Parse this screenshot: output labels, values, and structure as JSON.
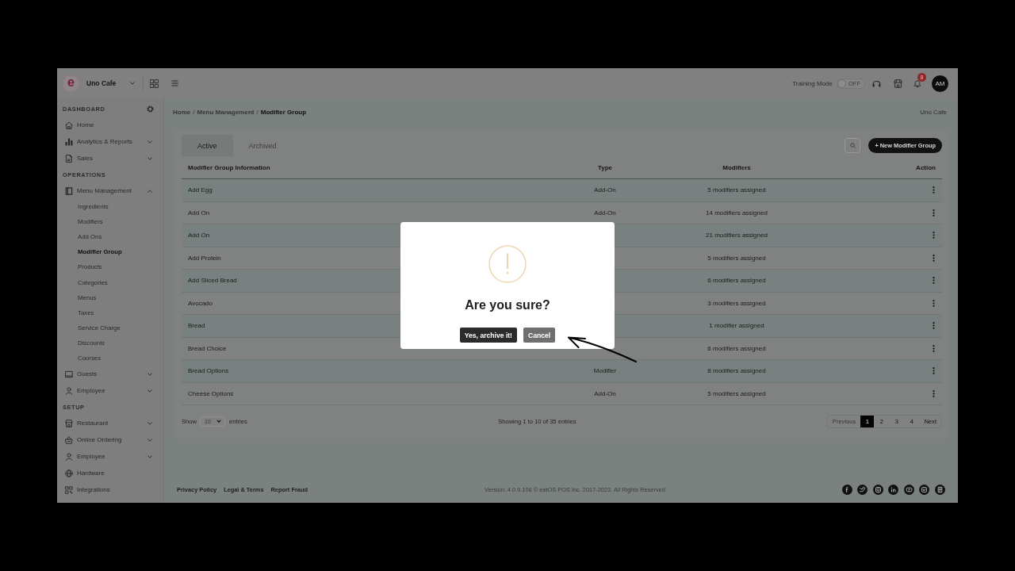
{
  "topbar": {
    "brand": {
      "logo": "e",
      "name": "Uno Cafe"
    },
    "training_mode": {
      "label": "Training Mode",
      "on": false,
      "state_label": "OFF"
    },
    "notifications": {
      "count": "8"
    },
    "avatar": {
      "initials": "AM"
    }
  },
  "sidebar": {
    "sections": [
      {
        "title": "DASHBOARD",
        "items": [
          {
            "label": "Home",
            "kind": "link",
            "selected": false
          },
          {
            "label": "Analytics & Reports",
            "kind": "group",
            "expanded": false,
            "selected": false
          },
          {
            "label": "Sales",
            "kind": "group",
            "expanded": false,
            "selected": false
          }
        ]
      },
      {
        "title": "OPERATIONS",
        "items": [
          {
            "label": "Menu Management",
            "kind": "group",
            "expanded": true,
            "selected": false,
            "children": [
              {
                "label": "Ingredients",
                "selected": false
              },
              {
                "label": "Modifiers",
                "selected": false
              },
              {
                "label": "Add Ons",
                "selected": false
              },
              {
                "label": "Modifier Group",
                "selected": true
              },
              {
                "label": "Products",
                "selected": false
              },
              {
                "label": "Categories",
                "selected": false
              },
              {
                "label": "Menus",
                "selected": false
              },
              {
                "label": "Taxes",
                "selected": false
              },
              {
                "label": "Service Charge",
                "selected": false
              },
              {
                "label": "Discounts",
                "selected": false
              },
              {
                "label": "Courses",
                "selected": false
              }
            ]
          },
          {
            "label": "Guests",
            "kind": "group",
            "expanded": false,
            "selected": false
          },
          {
            "label": "Employee",
            "kind": "group",
            "expanded": false,
            "selected": false
          }
        ]
      },
      {
        "title": "SETUP",
        "items": [
          {
            "label": "Restaurant",
            "kind": "group",
            "expanded": false,
            "selected": false
          },
          {
            "label": "Online Ordering",
            "kind": "group",
            "expanded": false,
            "selected": false
          },
          {
            "label": "Employee",
            "kind": "group",
            "expanded": false,
            "selected": false
          },
          {
            "label": "Hardware",
            "kind": "link",
            "selected": false
          },
          {
            "label": "Integrations",
            "kind": "link",
            "selected": false
          }
        ]
      }
    ]
  },
  "content": {
    "breadcrumb": {
      "items": [
        "Home",
        "Menu Management",
        "Modifier Group"
      ],
      "separator": "/"
    },
    "location": "Uno Cafe",
    "tabs": [
      {
        "label": "Active",
        "selected": true
      },
      {
        "label": "Archived",
        "selected": false
      }
    ],
    "new_button": "+ New Modifier Group",
    "table": {
      "columns": [
        "Modifier Group Information",
        "Type",
        "Modifiers",
        "Action"
      ],
      "rows": [
        {
          "name": "Add Egg",
          "type": "Add-On",
          "modifiers": "5 modifiers assigned"
        },
        {
          "name": "Add On",
          "type": "Add-On",
          "modifiers": "14 modifiers assigned"
        },
        {
          "name": "Add On",
          "modifiers": "21 modifiers assigned"
        },
        {
          "name": "Add Protein",
          "modifiers": "5 modifiers assigned"
        },
        {
          "name": "Add Sliced Bread",
          "modifiers": "6 modifiers assigned"
        },
        {
          "name": "Avocado",
          "modifiers": "3 modifiers assigned"
        },
        {
          "name": "Bread",
          "modifiers": "1 modifier assigned"
        },
        {
          "name": "Bread Choice",
          "modifiers": "6 modifiers assigned"
        },
        {
          "name": "Bread Options",
          "type": "Modifier",
          "modifiers": "8 modifiers assigned"
        },
        {
          "name": "Cheese Options",
          "type": "Add-On",
          "modifiers": "5 modifiers assigned"
        }
      ]
    },
    "page_length": {
      "label_before": "Show",
      "value": "10",
      "label_after": "entries"
    },
    "info": "Showing 1 to 10 of 35 entries",
    "pagination": {
      "previous": {
        "label": "Previous",
        "disabled": true
      },
      "pages": [
        {
          "label": "1",
          "selected": true
        },
        {
          "label": "2",
          "selected": false
        },
        {
          "label": "3",
          "selected": false
        },
        {
          "label": "4",
          "selected": false
        }
      ],
      "next": {
        "label": "Next",
        "disabled": false
      }
    }
  },
  "footer": {
    "links": [
      "Privacy Policy",
      "Legal & Terms",
      "Report Fraud"
    ],
    "copyright": "Version: 4.0.9.108 © eatOS POS Inc. 2017-2023. All Rights Reserved"
  },
  "dialog": {
    "title": "Are you sure?",
    "buttons": [
      {
        "label": "Yes, archive it!",
        "kind": "confirm"
      },
      {
        "label": "Cancel",
        "kind": "cancel"
      }
    ]
  }
}
